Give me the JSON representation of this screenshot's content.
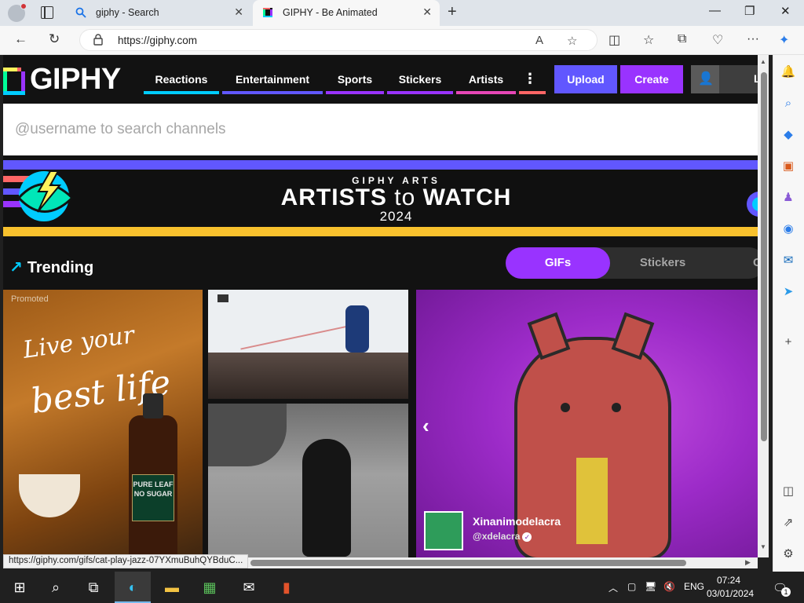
{
  "browser": {
    "tabs": [
      {
        "title": "giphy - Search",
        "icon": "search-icon",
        "active": false
      },
      {
        "title": "GIPHY - Be Animated",
        "icon": "giphy-favicon",
        "active": true
      }
    ],
    "url": "https://giphy.com",
    "status_url": "https://giphy.com/gifs/cat-play-jazz-07YXmuBuhQYBduC..."
  },
  "giphy": {
    "logo": "GIPHY",
    "nav": [
      {
        "label": "Reactions",
        "color": "#00ccff"
      },
      {
        "label": "Entertainment",
        "color": "#6157ff"
      },
      {
        "label": "Sports",
        "color": "#9933ff"
      },
      {
        "label": "Stickers",
        "color": "#9933ff"
      },
      {
        "label": "Artists",
        "color": "#e646b6"
      }
    ],
    "more_nav_color": "#ff6666",
    "upload_label": "Upload",
    "create_label": "Create",
    "login_label": "L",
    "search_placeholder": "@username to search channels",
    "banner": {
      "kicker": "GIPHY ARTS",
      "headline_part1": "ARTISTS",
      "headline_to": "to",
      "headline_part2": "WATCH",
      "year": "2024"
    },
    "trending_label": "Trending",
    "toggle": {
      "active": "GIFs",
      "inactive": "Stickers",
      "third": "C"
    },
    "gifs": [
      {
        "name": "promoted-gif",
        "promoted_label": "Promoted",
        "text_line1": "Live your",
        "text_line2": "best life",
        "bottle_label": "PURE LEAF NO SUGAR"
      },
      {
        "name": "hockey-gif"
      },
      {
        "name": "wednesday-gif"
      },
      {
        "name": "cat-jazz-gif",
        "creator_name": "Xinanimodelacra",
        "creator_handle": "@xdelacra"
      }
    ]
  },
  "taskbar": {
    "lang": "ENG",
    "time": "07:24",
    "date": "03/01/2024",
    "notifications": "1"
  }
}
